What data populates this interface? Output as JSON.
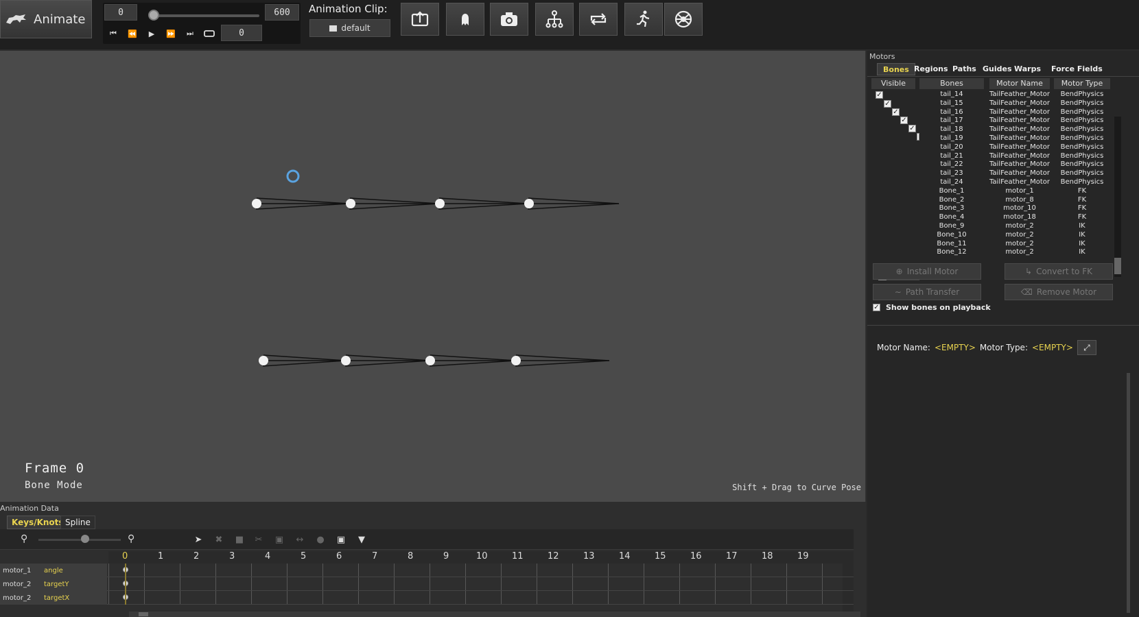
{
  "app": {
    "name": "Animate"
  },
  "transport": {
    "start": "0",
    "end": "600",
    "current": "0",
    "frame_slider": 0.0
  },
  "clip": {
    "label": "Animation Clip:",
    "value": "default"
  },
  "toolbar": {
    "tools": [
      "export-icon",
      "ghost-icon",
      "camera-icon",
      "hierarchy-icon",
      "loop-icon",
      "run-icon",
      "physics-icon"
    ]
  },
  "viewport": {
    "frame_label": "Frame 0",
    "mode_label": "Bone Mode",
    "hint": "Shift + Drag to Curve Pose"
  },
  "anim": {
    "title": "Animation Data",
    "tabs": [
      "Keys/Knots",
      "Spline"
    ],
    "ruler": [
      "0",
      "1",
      "2",
      "3",
      "4",
      "5",
      "6",
      "7",
      "8",
      "9",
      "10",
      "11",
      "12",
      "13",
      "14",
      "15",
      "16",
      "17",
      "18",
      "19"
    ],
    "tracks": [
      {
        "motor": "motor_1",
        "prop": "angle"
      },
      {
        "motor": "motor_2",
        "prop": "targetY"
      },
      {
        "motor": "motor_2",
        "prop": "targetX"
      }
    ]
  },
  "motors": {
    "title": "Motors",
    "tabs": [
      "Bones",
      "Regions",
      "Paths",
      "Guides",
      "Warps",
      "Force Fields"
    ],
    "headers": [
      "Visible",
      "Bones",
      "Motor Name",
      "Motor Type"
    ],
    "rows": [
      {
        "bone": "tail_14",
        "motor": "TailFeather_Motor",
        "type": "BendPhysics"
      },
      {
        "bone": "tail_15",
        "motor": "TailFeather_Motor",
        "type": "BendPhysics"
      },
      {
        "bone": "tail_16",
        "motor": "TailFeather_Motor",
        "type": "BendPhysics"
      },
      {
        "bone": "tail_17",
        "motor": "TailFeather_Motor",
        "type": "BendPhysics"
      },
      {
        "bone": "tail_18",
        "motor": "TailFeather_Motor",
        "type": "BendPhysics"
      },
      {
        "bone": "tail_19",
        "motor": "TailFeather_Motor",
        "type": "BendPhysics"
      },
      {
        "bone": "tail_20",
        "motor": "TailFeather_Motor",
        "type": "BendPhysics"
      },
      {
        "bone": "tail_21",
        "motor": "TailFeather_Motor",
        "type": "BendPhysics"
      },
      {
        "bone": "tail_22",
        "motor": "TailFeather_Motor",
        "type": "BendPhysics"
      },
      {
        "bone": "tail_23",
        "motor": "TailFeather_Motor",
        "type": "BendPhysics"
      },
      {
        "bone": "tail_24",
        "motor": "TailFeather_Motor",
        "type": "BendPhysics"
      },
      {
        "bone": "Bone_1",
        "motor": "motor_1",
        "type": "FK"
      },
      {
        "bone": "Bone_2",
        "motor": "motor_8",
        "type": "FK"
      },
      {
        "bone": "Bone_3",
        "motor": "motor_10",
        "type": "FK"
      },
      {
        "bone": "Bone_4",
        "motor": "motor_18",
        "type": "FK"
      },
      {
        "bone": "Bone_9",
        "motor": "motor_2",
        "type": "IK"
      },
      {
        "bone": "Bone_10",
        "motor": "motor_2",
        "type": "IK"
      },
      {
        "bone": "Bone_11",
        "motor": "motor_2",
        "type": "IK"
      },
      {
        "bone": "Bone_12",
        "motor": "motor_2",
        "type": "IK"
      }
    ],
    "buttons": {
      "install": "Install Motor",
      "convert": "Convert to FK",
      "path": "Path Transfer",
      "remove": "Remove Motor"
    },
    "show_bones": "Show bones on playback",
    "info": {
      "name_label": "Motor Name:",
      "name_value": "<EMPTY>",
      "type_label": "Motor Type:",
      "type_value": "<EMPTY>"
    }
  },
  "colors": {
    "accent": "#e8d34f",
    "viewport_bg": "#4a4a4a",
    "panel_bg": "#262626"
  }
}
